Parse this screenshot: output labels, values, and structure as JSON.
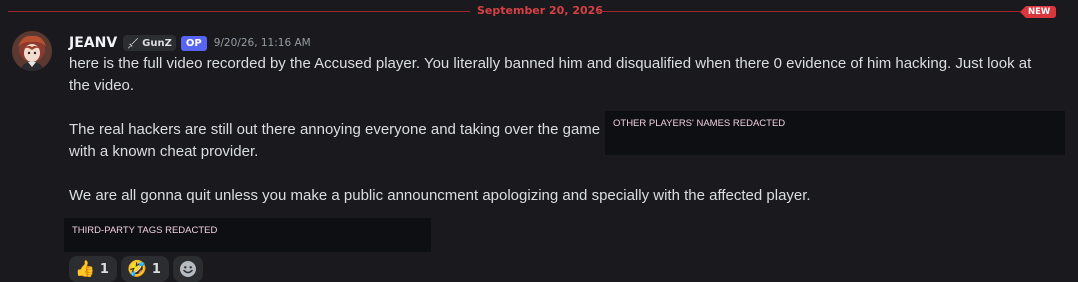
{
  "divider": {
    "date": "September 20, 2026",
    "new_label": "NEW"
  },
  "message": {
    "username": "JEANV",
    "guild_tag": "GunZ",
    "op_badge": "OP",
    "timestamp": "9/20/26, 11:16 AM",
    "paragraphs": [
      "here is the full video recorded by the Accused player. You literally banned him and disqualified when there 0 evidence of him hacking. Just look at the video.",
      "The real hackers are still out there annoying everyone and taking over the game",
      "with a known cheat provider.",
      "We are all gonna quit unless you make a public announcment apologizing and specially with the affected player."
    ],
    "redaction_inline": "OTHER PLAYERS' NAMES REDACTED",
    "redaction_block": "THIRD-PARTY TAGS REDACTED"
  },
  "reactions": [
    {
      "emoji": "👍",
      "count": "1",
      "icon": "thumbs-up-icon"
    },
    {
      "emoji": "🤣",
      "count": "1",
      "icon": "rofl-icon"
    }
  ],
  "add_reaction_icon": "smiley-add-icon",
  "colors": {
    "background": "#1a1a1e",
    "divider_red": "#d64045",
    "new_badge": "#da373c",
    "op_badge": "#5865f2"
  }
}
